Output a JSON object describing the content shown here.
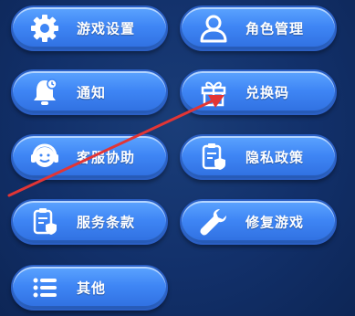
{
  "menu": {
    "game_settings": "游戏设置",
    "character_management": "角色管理",
    "notifications": "通知",
    "redeem_code": "兑换码",
    "customer_service": "客服协助",
    "privacy_policy": "隐私政策",
    "terms_of_service": "服务条款",
    "repair_game": "修复游戏",
    "other": "其他"
  },
  "colors": {
    "button_top": "#5ca4ff",
    "button_bottom": "#2f6fe0",
    "background": "#12306a",
    "arrow": "#e23535"
  }
}
